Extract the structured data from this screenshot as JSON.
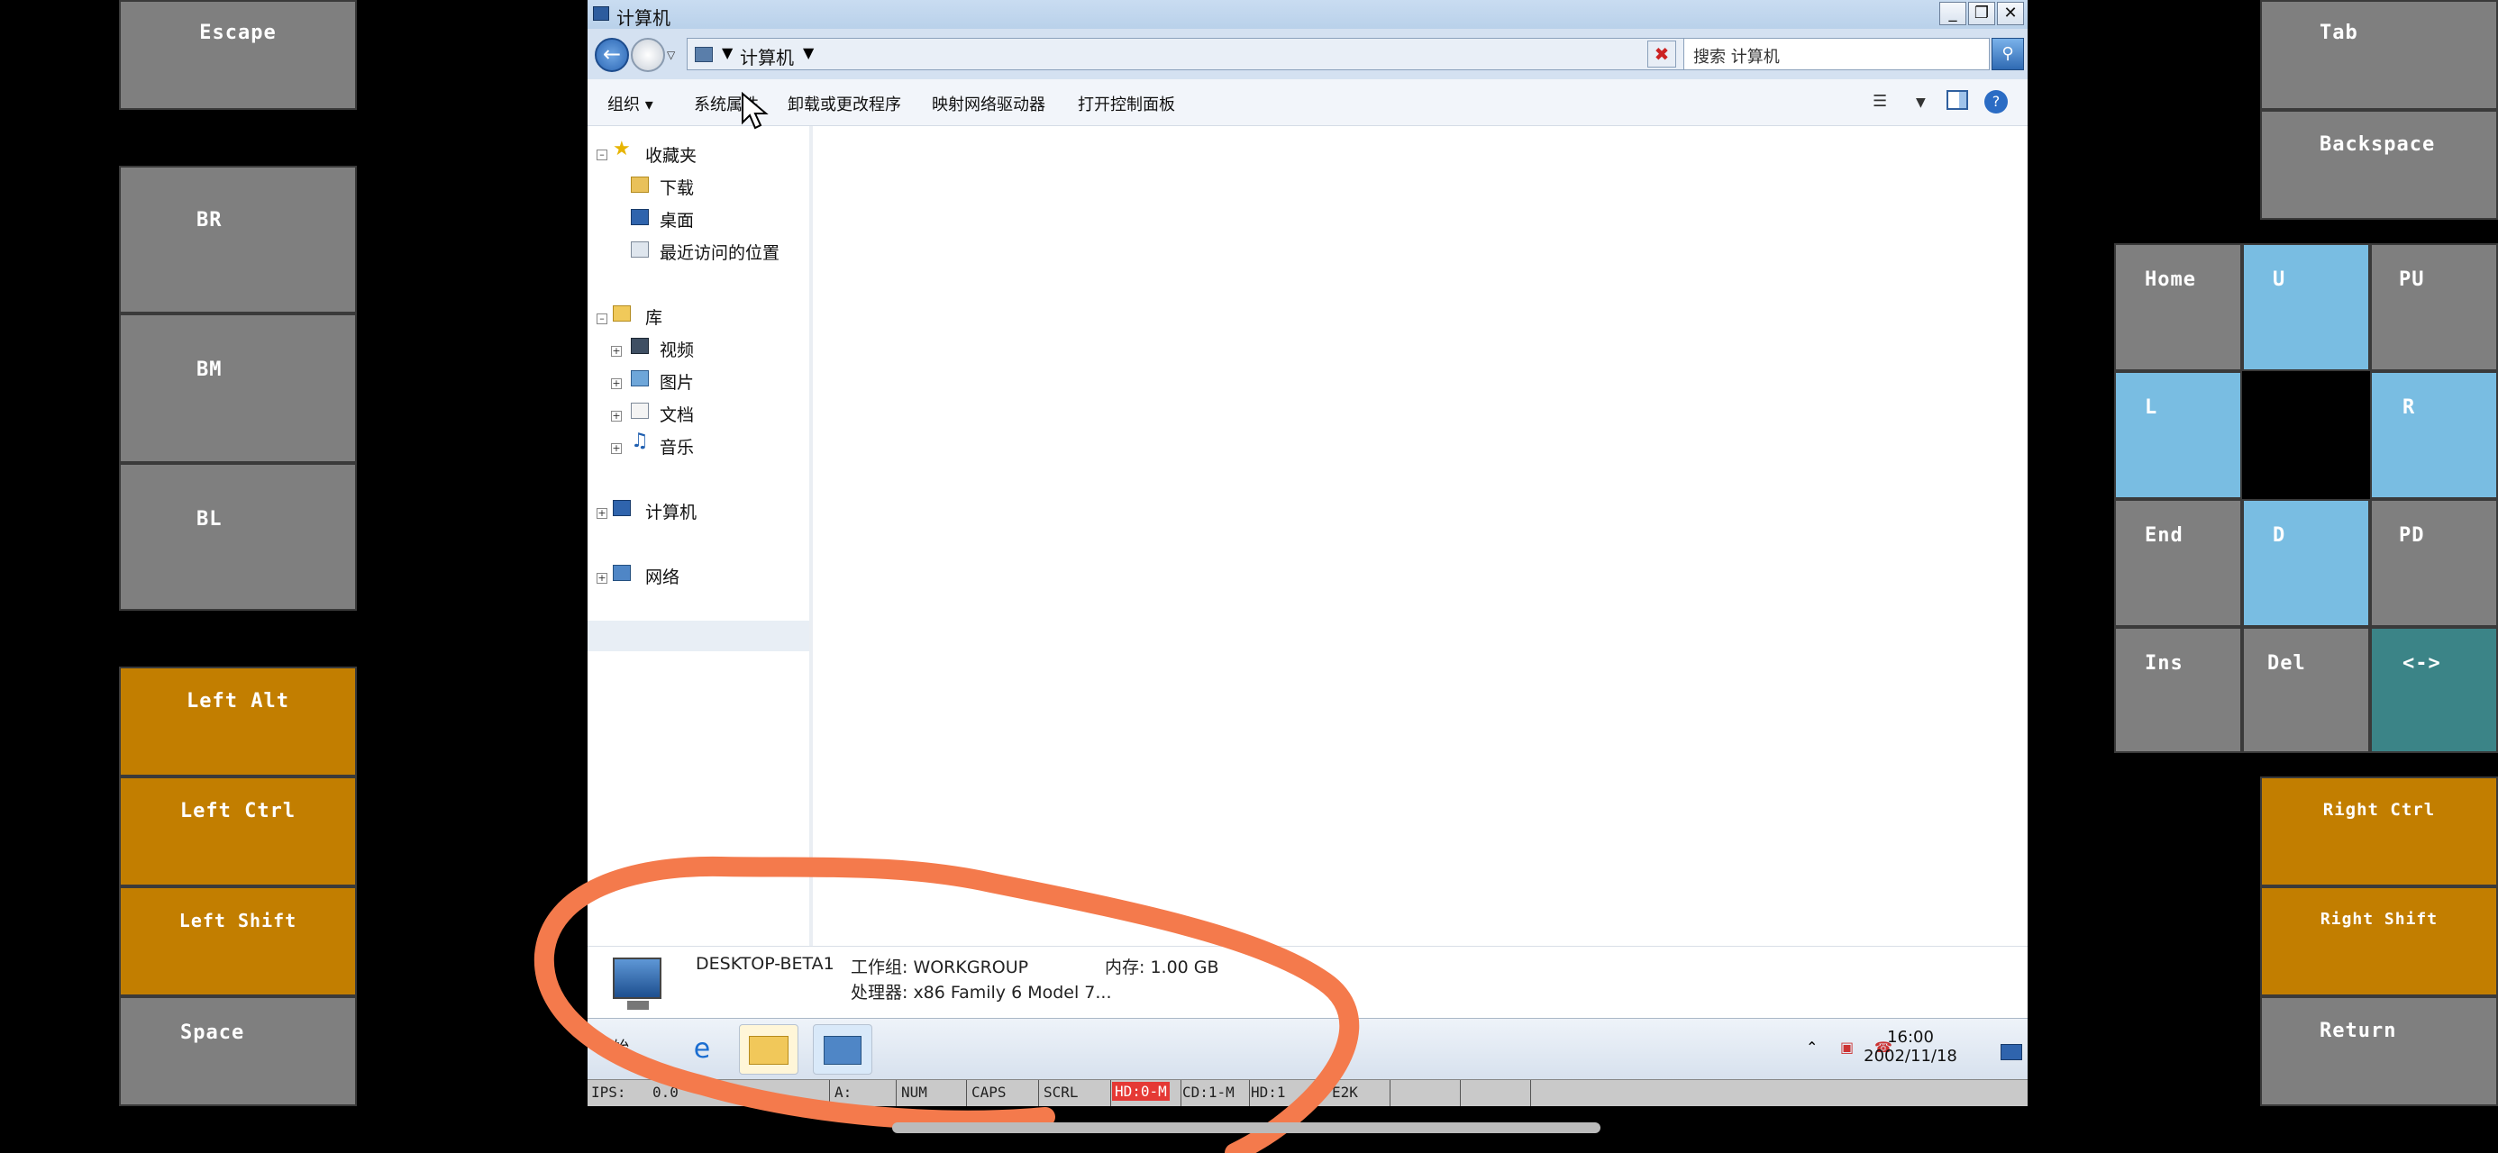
{
  "left_keys": [
    {
      "label": "Escape"
    },
    {
      "label": "BR"
    },
    {
      "label": "BM"
    },
    {
      "label": "BL"
    },
    {
      "label": "Left Alt"
    },
    {
      "label": "Left Ctrl"
    },
    {
      "label": "Left Shift"
    },
    {
      "label": "Space"
    }
  ],
  "right_keys": {
    "tab": "Tab",
    "backspace": "Backspace",
    "home": "Home",
    "up": "U",
    "page_up": "PU",
    "left": "L",
    "right": "R",
    "end": "End",
    "down": "D",
    "page_down": "PD",
    "insert": "Ins",
    "delete": "Del",
    "toggle": "<->",
    "right_ctrl": "Right Ctrl",
    "right_shift": "Right Shift",
    "return": "Return"
  },
  "window": {
    "title": "计算机",
    "minimize": "_",
    "maximize": "❐",
    "close": "✕"
  },
  "address": {
    "location": "计算机",
    "search_placeholder": "搜索 计算机"
  },
  "commands": {
    "organize": "组织 ▾",
    "system_properties": "系统属性",
    "uninstall": "卸载或更改程序",
    "map_drive": "映射网络驱动器",
    "control_panel": "打开控制面板"
  },
  "nav_tree": {
    "favorites": "收藏夹",
    "downloads": "下载",
    "desktop": "桌面",
    "recent": "最近访问的位置",
    "libraries": "库",
    "videos": "视频",
    "pictures": "图片",
    "documents": "文档",
    "music": "音乐",
    "computer": "计算机",
    "network": "网络"
  },
  "details": {
    "computer_name": "DESKTOP-BETA1",
    "workgroup": "工作组: WORKGROUP",
    "memory": "内存: 1.00 GB",
    "processor": "处理器: x86 Family 6 Model 7..."
  },
  "taskbar": {
    "start": "开始",
    "time": "16:00",
    "date": "2002/11/18"
  },
  "statusbar": {
    "ips": "IPS:",
    "ips_value": "0.0",
    "a": "A:",
    "num": "NUM",
    "caps": "CAPS",
    "scrl": "SCRL",
    "hd0": "HD:0-M",
    "cd1": "CD:1-M",
    "hd1": "HD:1",
    "e2k": "E2K"
  },
  "colors": {
    "key_gray": "#7f7f7f",
    "key_orange": "#c27e00",
    "key_blue": "#79bde2",
    "key_teal": "#3b8487",
    "annotation": "#f47a4c",
    "hd_active": "#e53935"
  }
}
